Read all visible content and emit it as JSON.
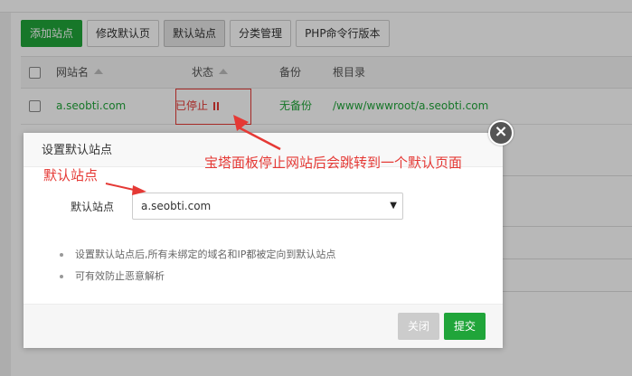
{
  "toolbar": {
    "add_site": "添加站点",
    "edit_default_page": "修改默认页",
    "default_site": "默认站点",
    "category_manage": "分类管理",
    "php_cli_version": "PHP命令行版本"
  },
  "table": {
    "headers": [
      "网站名",
      "状态",
      "备份",
      "根目录"
    ],
    "rows": [
      {
        "name": "a.seobti.com",
        "status": "已停止",
        "backup": "无备份",
        "root": "/www/wwwroot/a.seobti.com"
      }
    ]
  },
  "modal": {
    "title": "设置默认站点",
    "field_label": "默认站点",
    "selected_value": "a.seobti.com",
    "tips": [
      "设置默认站点后,所有未绑定的域名和IP都被定向到默认站点",
      "可有效防止恶意解析"
    ],
    "close_label": "关闭",
    "submit_label": "提交"
  },
  "annotations": {
    "main": "宝塔面板停止网站后会跳转到一个默认页面",
    "default_site": "默认站点"
  },
  "colors": {
    "primary_green": "#20a53a",
    "annotation_red": "#e53935"
  }
}
